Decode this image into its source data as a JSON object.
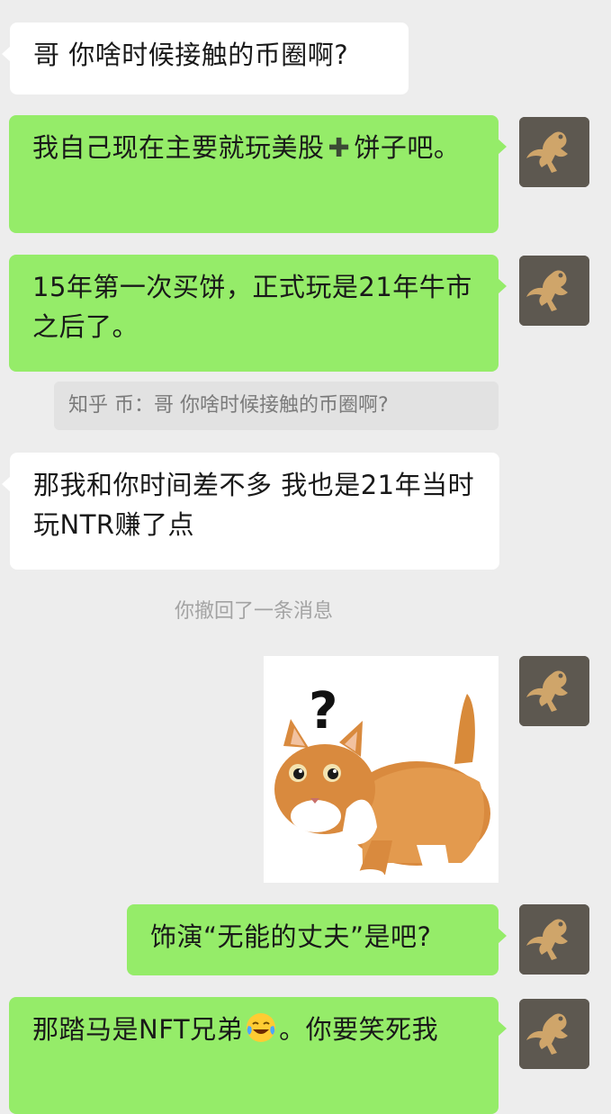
{
  "messages": [
    {
      "side": "left",
      "text": "哥 你啥时候接触的币圈啊?"
    },
    {
      "side": "right",
      "text_before": "我自己现在主要就玩美股",
      "plus_icon": "heavy-plus-sign",
      "text_after": "饼子吧。"
    },
    {
      "side": "right",
      "text": "15年第一次买饼，正式玩是21年牛市之后了。"
    },
    {
      "side": "left",
      "text": "那我和你时间差不多 我也是21年当时玩NTR赚了点"
    },
    {
      "side": "right",
      "type": "sticker",
      "description_icon": "confused-cat-sticker",
      "mark": "?"
    },
    {
      "side": "right",
      "text": "饰演“无能的丈夫”是吧?"
    },
    {
      "side": "right",
      "text_before": "那踏马是NFT兄弟",
      "emoji": "laughing-crying-emoji",
      "text_after": "。你要笑死我"
    }
  ],
  "quote": {
    "text": "知乎 币：哥 你啥时候接触的币圈啊?"
  },
  "system_notice": {
    "text": "你撤回了一条消息"
  },
  "colors": {
    "background": "#ededed",
    "incoming": "#ffffff",
    "outgoing": "#95ec69"
  }
}
